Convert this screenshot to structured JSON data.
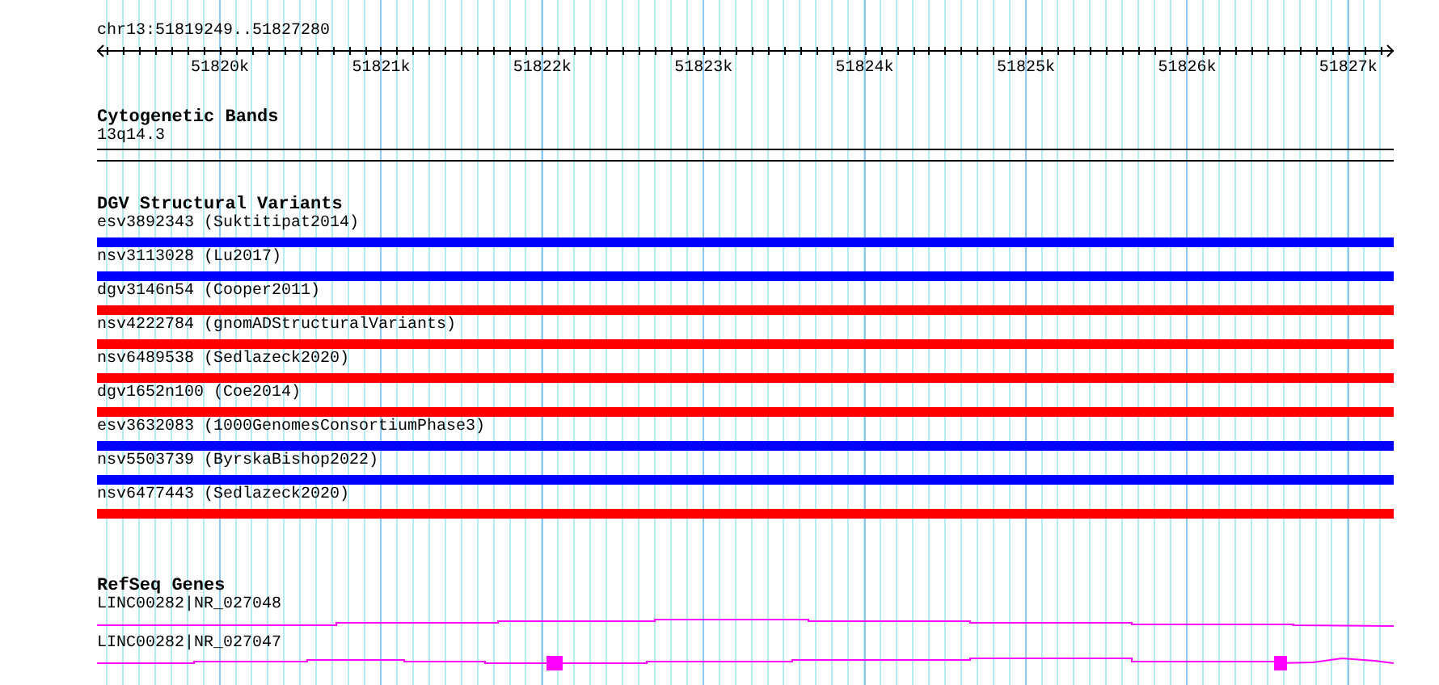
{
  "ruler": {
    "location": "chr13:51819249..51827280",
    "ticks": [
      "51820k",
      "51821k",
      "51822k",
      "51823k",
      "51824k",
      "51825k",
      "51826k",
      "51827k"
    ]
  },
  "cytogenetic_bands": {
    "title": "Cytogenetic Bands",
    "band": "13q14.3"
  },
  "dgv_structural_variants": {
    "title": "DGV Structural Variants",
    "variants": [
      {
        "label": "esv3892343 (Suktitipat2014)",
        "color": "#0000ff"
      },
      {
        "label": "nsv3113028 (Lu2017)",
        "color": "#0000ff"
      },
      {
        "label": "dgv3146n54 (Cooper2011)",
        "color": "#ff0000"
      },
      {
        "label": "nsv4222784 (gnomADStructuralVariants)",
        "color": "#ff0000"
      },
      {
        "label": "nsv6489538 (Sedlazeck2020)",
        "color": "#ff0000"
      },
      {
        "label": "dgv1652n100 (Coe2014)",
        "color": "#ff0000"
      },
      {
        "label": "esv3632083 (1000GenomesConsortiumPhase3)",
        "color": "#0000ff"
      },
      {
        "label": "nsv5503739 (ByrskaBishop2022)",
        "color": "#0000ff"
      },
      {
        "label": "nsv6477443 (Sedlazeck2020)",
        "color": "#ff0000"
      }
    ]
  },
  "refseq_genes": {
    "title": "RefSeq Genes",
    "genes": [
      {
        "label": "LINC00282|NR_027048"
      },
      {
        "label": "LINC00282|NR_027047"
      }
    ]
  }
}
